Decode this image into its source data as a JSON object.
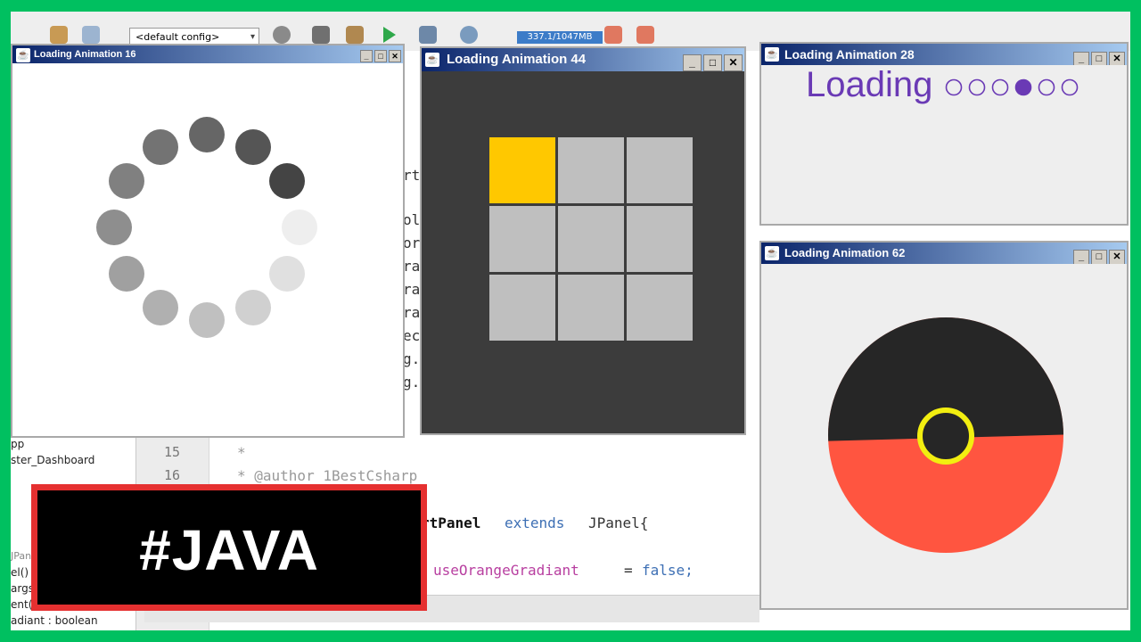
{
  "toolbar": {
    "config_label": "<default config>",
    "memory_label": "337.1/1047MB"
  },
  "editor": {
    "line_numbers": [
      "15",
      "16"
    ],
    "lines": [
      {
        "num": "15",
        "text": "*"
      },
      {
        "num": "16",
        "text": "* @author 1BestCsharp"
      }
    ],
    "class_line": {
      "part1": "rtPanel",
      "part2": "extends",
      "part3": "JPanel{"
    },
    "field_line": {
      "name": "useOrangeGradiant",
      "op": "=",
      "value": "false;"
    },
    "hidden_fragments": [
      "rt",
      "ol",
      "or",
      "ra",
      "ra",
      "ra",
      "ec",
      "g.",
      "g."
    ]
  },
  "left_nav": {
    "items": [
      "pp",
      "ster_Dashboard",
      "JPan",
      "el()",
      "args",
      "ent(",
      "adiant : boolean"
    ]
  },
  "windows": {
    "w16": {
      "title": "Loading Animation 16"
    },
    "w44": {
      "title": "Loading Animation 44"
    },
    "w28": {
      "title": "Loading Animation 28",
      "loading_text": "Loading",
      "dots": 6,
      "active_dot": 4
    },
    "w62": {
      "title": "Loading Animation 62"
    }
  },
  "banner": {
    "text": "#JAVA"
  },
  "colors": {
    "frame_green": "#00c060",
    "banner_border": "#e53030",
    "tile_active": "#ffc800",
    "tile_idle": "#bfbfbf",
    "panel_dark": "#3c3c3c",
    "loading_purple": "#6a3ab5",
    "pokeball_top": "#262626",
    "pokeball_bottom": "#ff5540",
    "pokeball_ring": "#f2ee10"
  }
}
